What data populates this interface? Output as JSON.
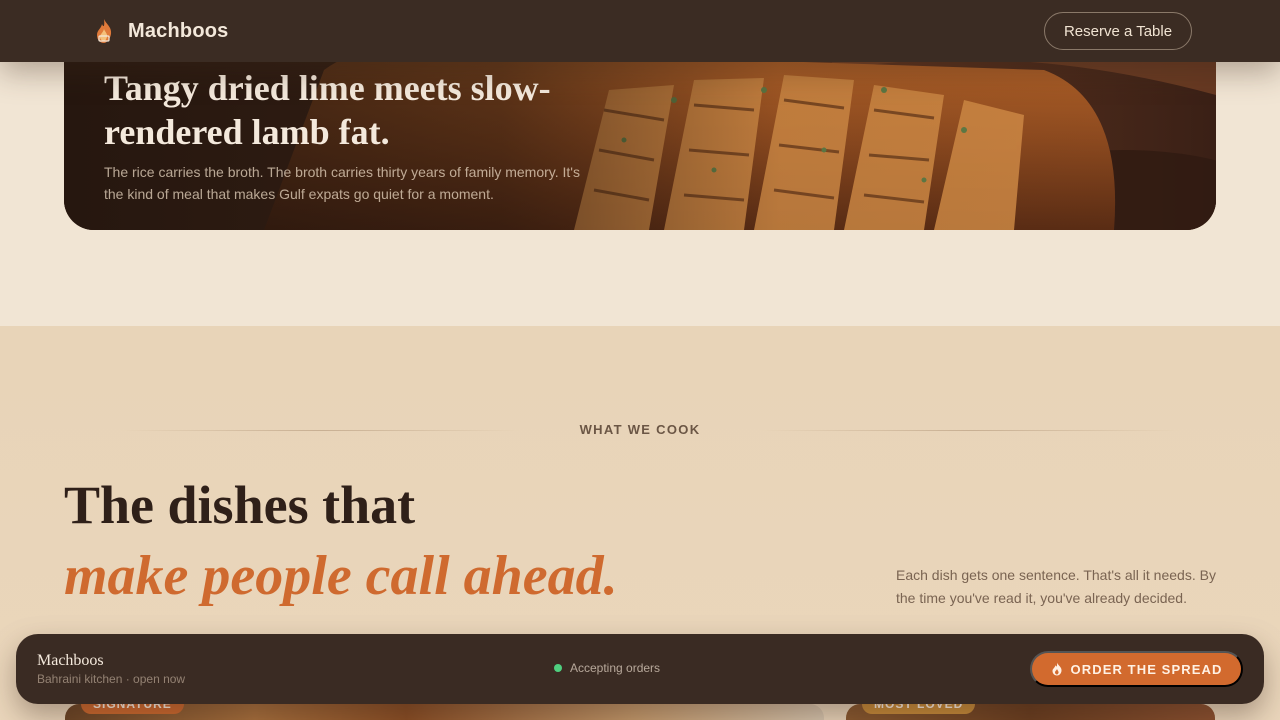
{
  "header": {
    "brand_name": "Machboos",
    "logo_icon": "flame-logo-icon",
    "reserve_label": "Reserve a Table"
  },
  "hero": {
    "title": "Tangy dried lime meets slow-rendered lamb fat.",
    "subtitle": "The rice carries the broth. The broth carries thirty years of family memory. It's the kind of meal that makes Gulf expats go quiet for a moment."
  },
  "menu_section": {
    "eyebrow": "WHAT WE COOK",
    "heading_line1": "The dishes that",
    "heading_line2": "make people call ahead.",
    "description": "Each dish gets one sentence. That's all it needs. By the time you've read it, you've already decided.",
    "cards": [
      {
        "tag": "SIGNATURE"
      },
      {
        "tag": "MOST LOVED"
      }
    ]
  },
  "bottom_bar": {
    "name": "Machboos",
    "subtitle": "Bahraini kitchen · open now",
    "status": "Accepting orders",
    "order_label": "ORDER THE SPREAD",
    "order_icon": "flame-icon"
  },
  "colors": {
    "accent": "#d26a2e",
    "nav_bg": "#3b2c23",
    "status_green": "#4fcf7f"
  }
}
